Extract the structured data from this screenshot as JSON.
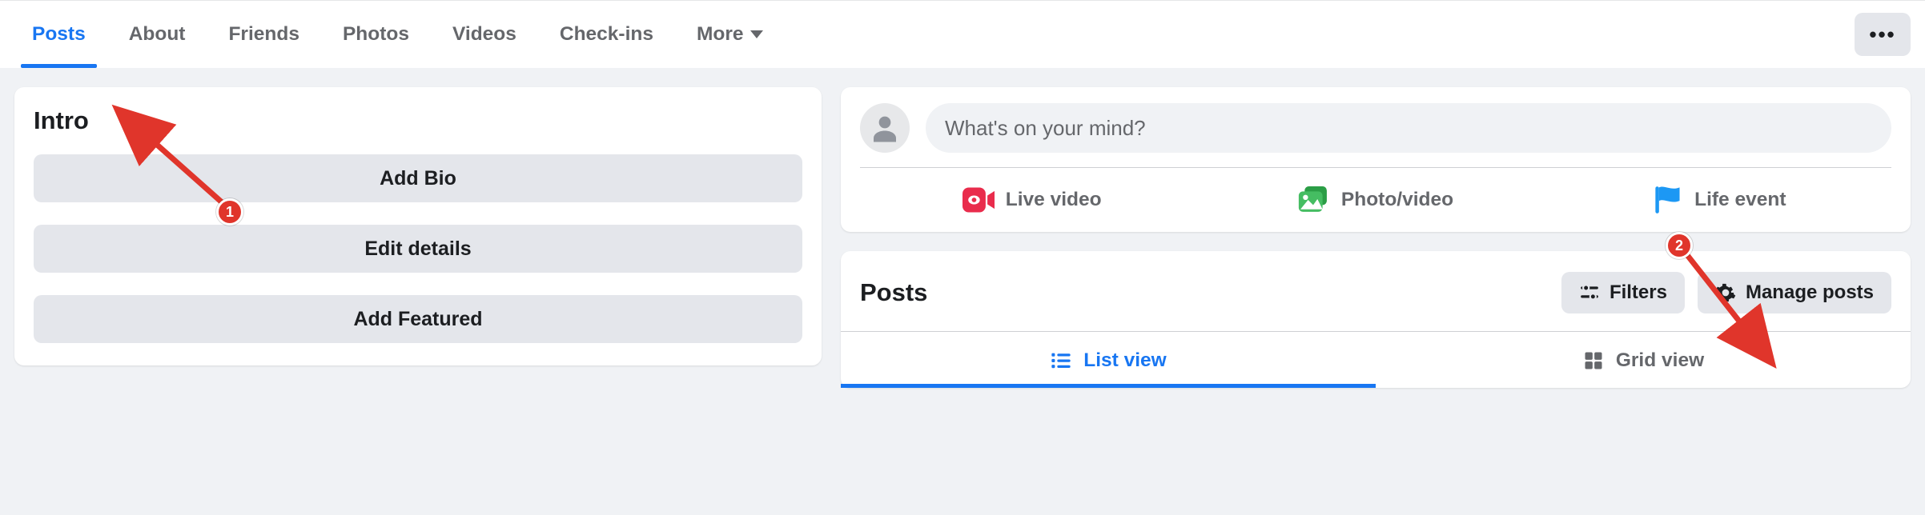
{
  "nav": {
    "tabs": [
      {
        "label": "Posts"
      },
      {
        "label": "About"
      },
      {
        "label": "Friends"
      },
      {
        "label": "Photos"
      },
      {
        "label": "Videos"
      },
      {
        "label": "Check-ins"
      }
    ],
    "more_label": "More",
    "ellipsis": "•••"
  },
  "intro": {
    "title": "Intro",
    "add_bio": "Add Bio",
    "edit_details": "Edit details",
    "add_featured": "Add Featured"
  },
  "composer": {
    "placeholder": "What's on your mind?",
    "live_video": "Live video",
    "photo_video": "Photo/video",
    "life_event": "Life event"
  },
  "posts": {
    "title": "Posts",
    "filters": "Filters",
    "manage": "Manage posts",
    "list_view": "List view",
    "grid_view": "Grid view"
  },
  "annotations": {
    "badge1": "1",
    "badge2": "2"
  }
}
